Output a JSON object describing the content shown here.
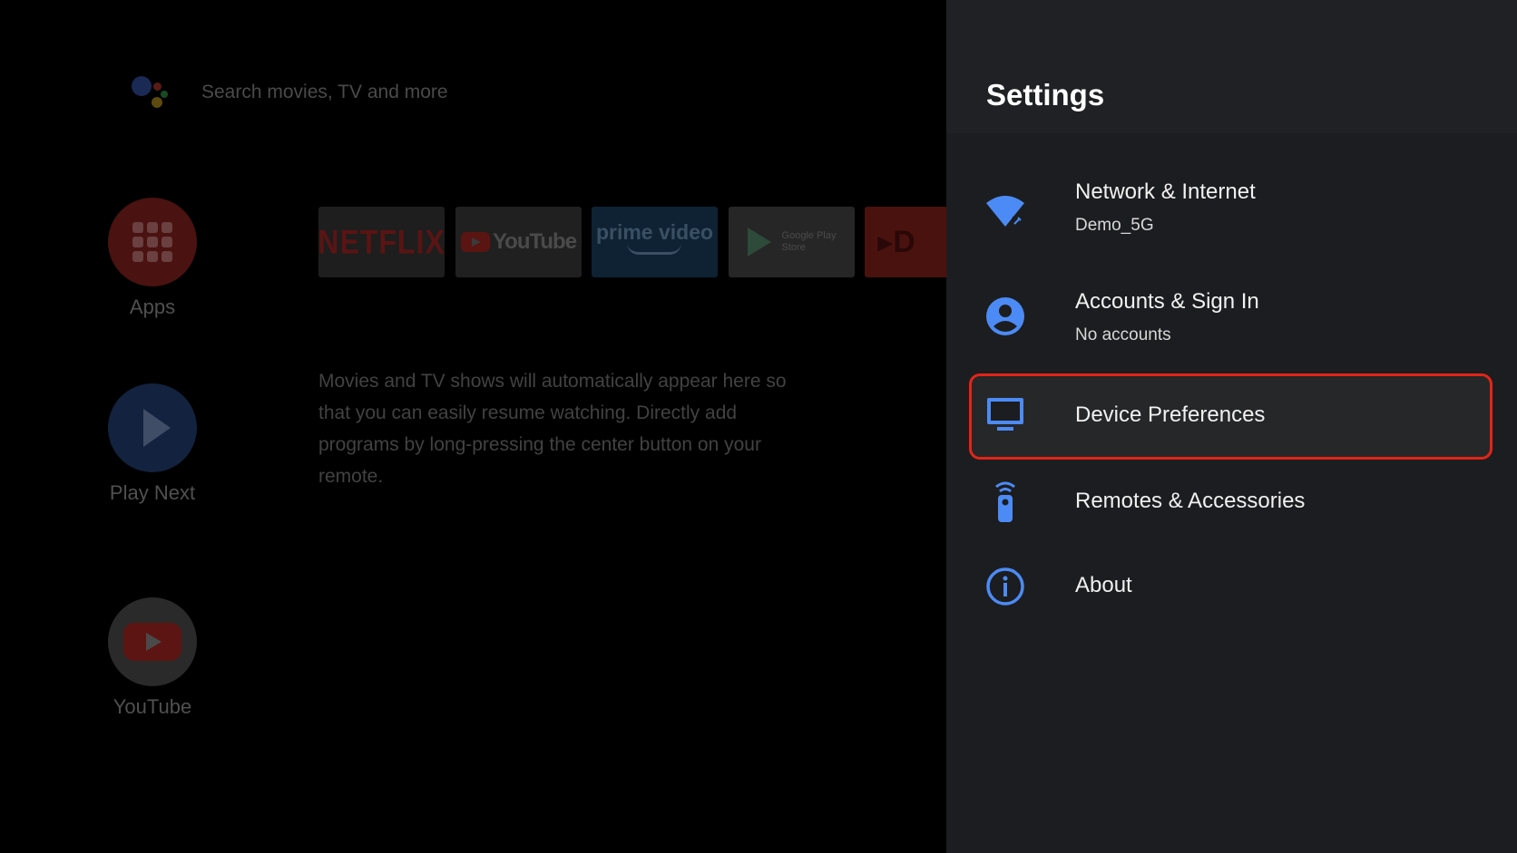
{
  "home": {
    "search_placeholder": "Search movies, TV and more",
    "side_items": [
      {
        "label": "Apps"
      },
      {
        "label": "Play Next"
      },
      {
        "label": "YouTube"
      }
    ],
    "app_cards": [
      {
        "name": "NETFLIX"
      },
      {
        "name": "YouTube"
      },
      {
        "name": "prime video"
      },
      {
        "name": "Google Play Store",
        "line1": "Google Play",
        "line2": "Store"
      }
    ],
    "play_next_message": "Movies and TV shows will automatically appear here so that you can easily resume watching. Directly add programs by long-pressing the center button on your remote."
  },
  "settings": {
    "title": "Settings",
    "items": [
      {
        "title": "Network & Internet",
        "subtitle": "Demo_5G",
        "icon": "wifi-icon"
      },
      {
        "title": "Accounts & Sign In",
        "subtitle": "No accounts",
        "icon": "account-icon"
      },
      {
        "title": "Device Preferences",
        "subtitle": "",
        "icon": "tv-icon",
        "focused": true
      },
      {
        "title": "Remotes & Accessories",
        "subtitle": "",
        "icon": "remote-icon"
      },
      {
        "title": "About",
        "subtitle": "",
        "icon": "info-icon"
      }
    ]
  },
  "colors": {
    "panel_bg": "#1c1d20",
    "header_bg": "#202124",
    "icon_blue": "#4c8bf5",
    "highlight_border": "#e32418"
  }
}
